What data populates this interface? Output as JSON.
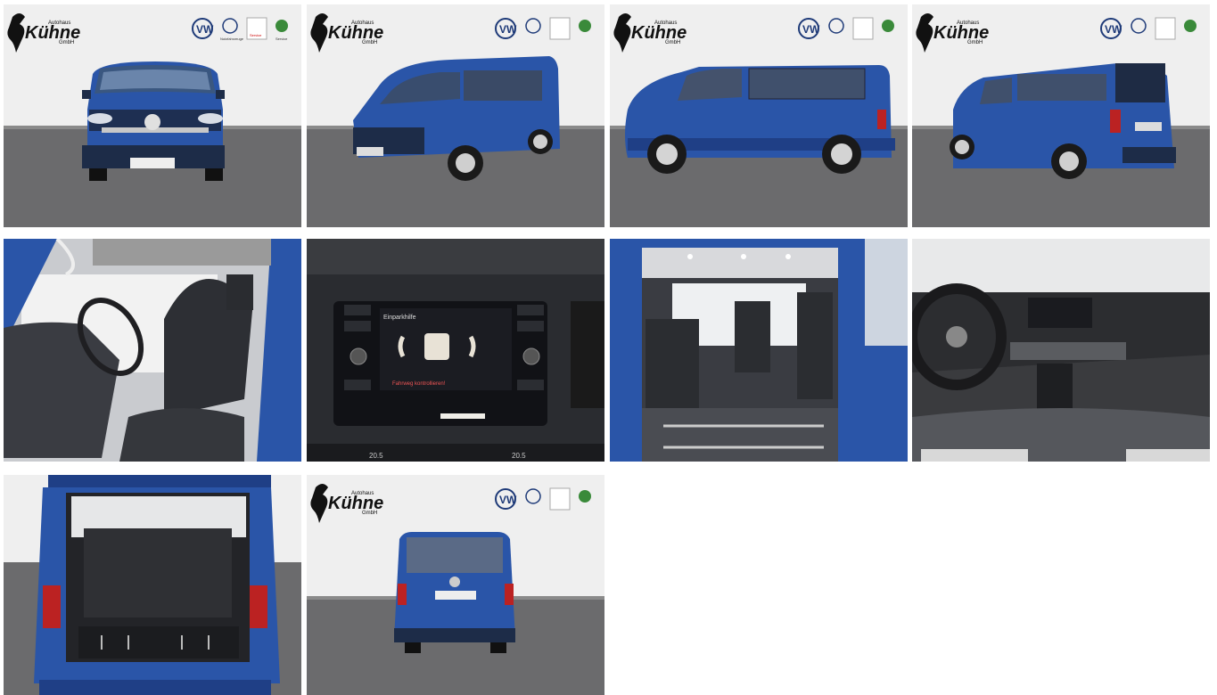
{
  "gallery": {
    "photos": [
      {
        "view": "front"
      },
      {
        "view": "front-left-three-quarter"
      },
      {
        "view": "left-side"
      },
      {
        "view": "rear-left-three-quarter"
      },
      {
        "view": "cabin-driver-seat"
      },
      {
        "view": "infotainment-parking-display"
      },
      {
        "view": "passenger-compartment"
      },
      {
        "view": "dashboard-steering-wheel"
      },
      {
        "view": "open-trunk"
      },
      {
        "view": "rear"
      }
    ],
    "dealer": {
      "name": "Kühne",
      "tagline_top": "Autohaus",
      "tagline_bottom": "GmbH",
      "partner_1": "Nutzfahrzeuge",
      "partner_2": "Service",
      "partner_3": "Service"
    },
    "display": {
      "title": "Einparkhilfe",
      "warning": "Fahrweg kontrollieren!"
    },
    "climate": {
      "left_temp": "20.5",
      "right_temp": "20.5"
    },
    "colors": {
      "van_blue": "#2a55a8",
      "van_dark": "#1d3c7c",
      "ground": "#6a6a6c",
      "wall": "#eeeeee"
    }
  }
}
